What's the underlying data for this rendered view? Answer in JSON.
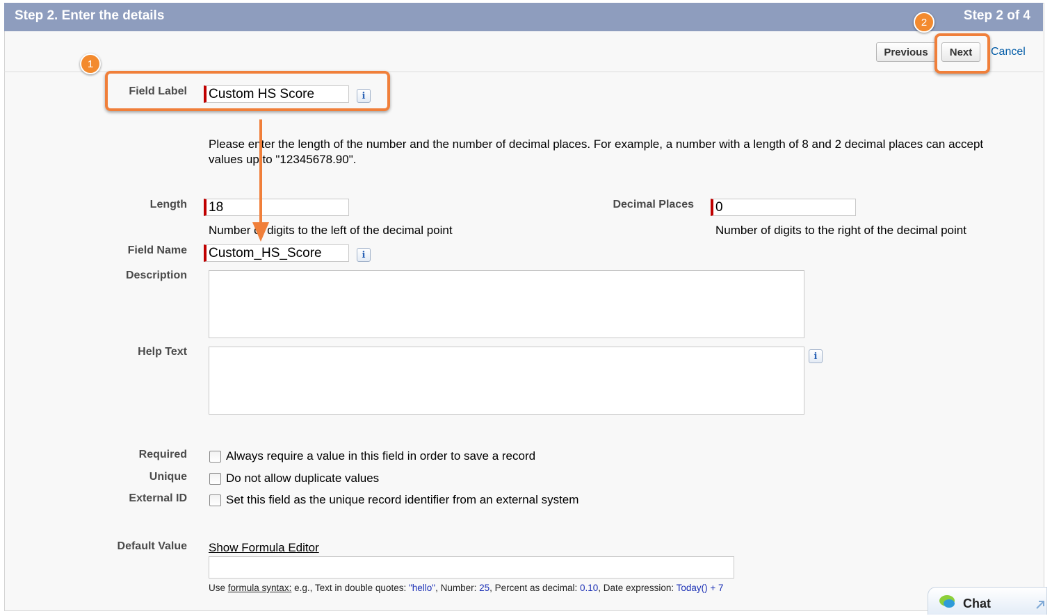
{
  "header": {
    "title": "Step 2. Enter the details",
    "step": "Step 2 of 4"
  },
  "toolbar": {
    "previous": "Previous",
    "next": "Next",
    "cancel": "Cancel"
  },
  "annotations": {
    "badge1": "1",
    "badge2": "2"
  },
  "field_label": {
    "label": "Field Label",
    "value": "Custom HS Score"
  },
  "instructions": "Please enter the length of the number and the number of decimal places. For example, a number with a length of 8 and 2 decimal places can accept values up to \"12345678.90\".",
  "length": {
    "label": "Length",
    "value": "18",
    "help": "Number of digits to the left of the decimal point"
  },
  "decimal_places": {
    "label": "Decimal Places",
    "value": "0",
    "help": "Number of digits to the right of the decimal point"
  },
  "field_name": {
    "label": "Field Name",
    "value": "Custom_HS_Score"
  },
  "description": {
    "label": "Description",
    "value": ""
  },
  "help_text": {
    "label": "Help Text",
    "value": ""
  },
  "info_glyph": "i",
  "required": {
    "label": "Required",
    "text": "Always require a value in this field in order to save a record",
    "checked": false
  },
  "unique": {
    "label": "Unique",
    "text": "Do not allow duplicate values",
    "checked": false
  },
  "external_id": {
    "label": "External ID",
    "text": "Set this field as the unique record identifier from an external system",
    "checked": false
  },
  "default_value": {
    "label": "Default Value",
    "formula_link": "Show Formula Editor",
    "value": "",
    "hint": {
      "use": "Use",
      "syntax_link": "formula syntax:",
      "eg_text": "e.g., Text in double quotes:",
      "text_example": "\"hello\"",
      "number_text": ", Number:",
      "number_example": "25",
      "percent_text": ", Percent as decimal:",
      "percent_example": "0.10",
      "date_text": ", Date expression:",
      "date_example": "Today() + 7"
    }
  },
  "chat": {
    "label": "Chat"
  },
  "colors": {
    "header_bg": "#8e9dbe",
    "callout": "#f07f3a",
    "required_marker": "#c00000",
    "link": "#015ba7"
  }
}
